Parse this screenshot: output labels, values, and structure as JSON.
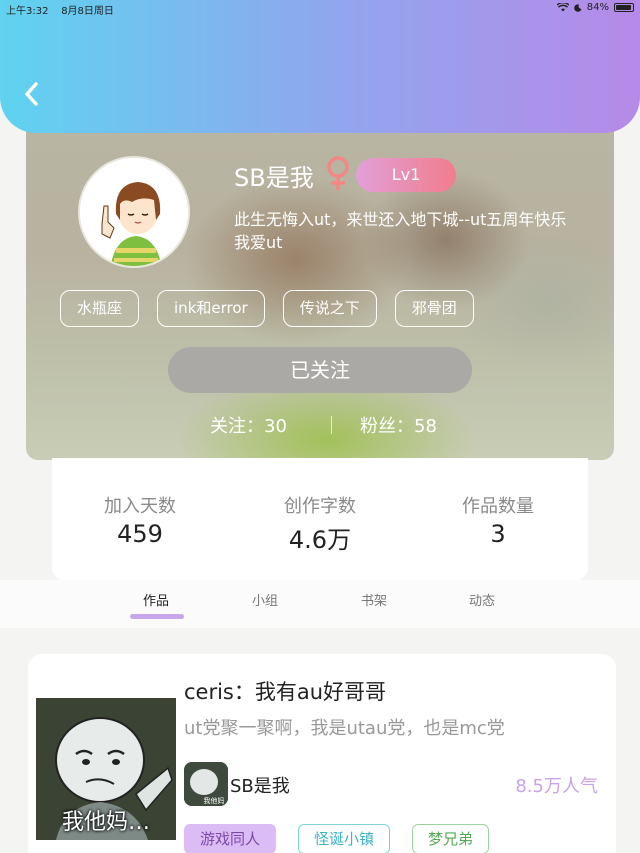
{
  "status_bar": {
    "time": "上午3:32",
    "date": "8月8日周日",
    "battery": "84%"
  },
  "profile": {
    "username": "SB是我",
    "level": "Lv1",
    "bio_line1": "此生无悔入ut，来世还入地下城--ut五周年快乐",
    "bio_line2": "我爱ut",
    "tags": [
      "水瓶座",
      "ink和error",
      "传说之下",
      "邪骨团"
    ],
    "follow_button": "已关注",
    "following": "关注：30",
    "fans": "粉丝：58"
  },
  "stats": [
    {
      "label": "加入天数",
      "value": "459"
    },
    {
      "label": "创作字数",
      "value": "4.6万"
    },
    {
      "label": "作品数量",
      "value": "3"
    }
  ],
  "tabs": [
    "作品",
    "小组",
    "书架",
    "动态"
  ],
  "work": {
    "cover_text": "我他妈…",
    "title": "ceris：我有au好哥哥",
    "description": "ut党聚一聚啊，我是utau党，也是mc党",
    "author_avatar_text": "我他妈",
    "author": "SB是我",
    "popularity": "8.5万人气",
    "tags": [
      "游戏同人",
      "怪诞小镇",
      "梦兄弟"
    ]
  },
  "colors": {
    "header_gradient_start": "#5fd3f0",
    "header_gradient_end": "#b68ae8",
    "accent_purple": "#c8a3ea",
    "level_badge_end": "#f17d8c"
  }
}
